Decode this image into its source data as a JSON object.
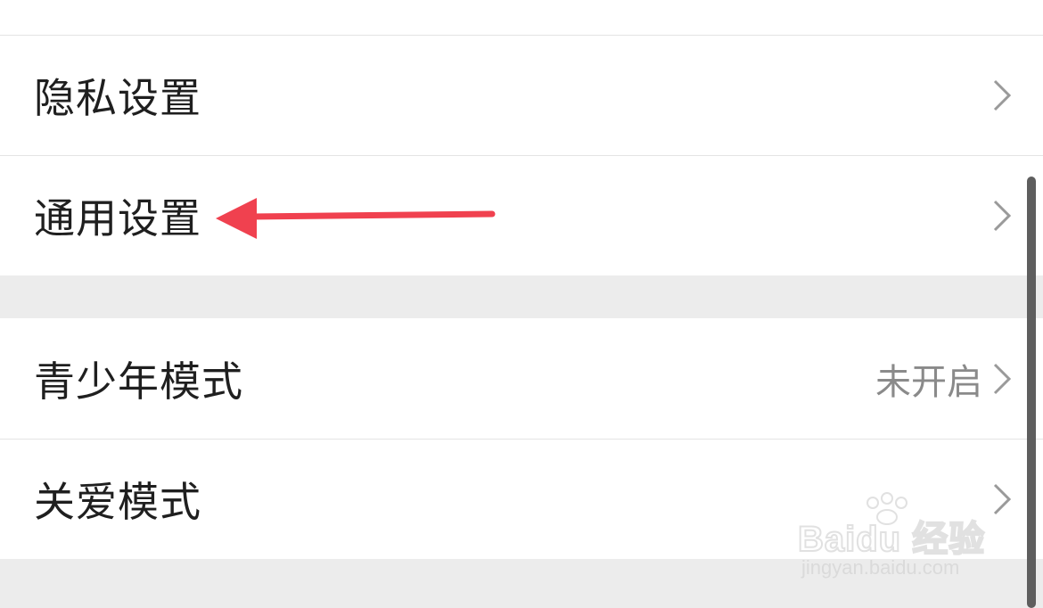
{
  "settings": {
    "items": [
      {
        "label": "隐私设置",
        "value": ""
      },
      {
        "label": "通用设置",
        "value": ""
      },
      {
        "label": "青少年模式",
        "value": "未开启"
      },
      {
        "label": "关爱模式",
        "value": ""
      }
    ]
  },
  "annotation": {
    "arrow_color": "#f0414f",
    "points_to": "通用设置"
  },
  "watermark": {
    "brand": "Baidu 经验",
    "url": "jingyan.baidu.com"
  },
  "colors": {
    "background": "#ffffff",
    "section_gap": "#ececec",
    "divider": "#e4e4e4",
    "label_text": "#1f1f1f",
    "value_text": "#8a8a8a",
    "chevron": "#9a9a9a",
    "scrollbar": "#5e5e5e"
  }
}
